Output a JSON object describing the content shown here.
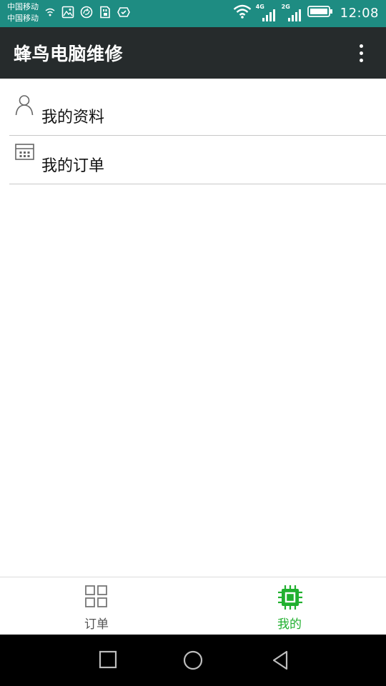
{
  "status_bar": {
    "carrier_1": "中国移动",
    "carrier_2": "中国移动",
    "network_1": "4G",
    "network_2": "2G",
    "time": "12:08"
  },
  "app_bar": {
    "title": "蜂鸟电脑维修"
  },
  "menu": {
    "items": [
      {
        "label": "我的资料",
        "icon": "person-icon"
      },
      {
        "label": "我的订单",
        "icon": "calendar-icon"
      }
    ]
  },
  "tabs": [
    {
      "label": "订单",
      "icon": "grid-icon",
      "active": false
    },
    {
      "label": "我的",
      "icon": "chip-icon",
      "active": true
    }
  ],
  "colors": {
    "status_bar": "#1e8c82",
    "app_bar": "#262b2c",
    "active_tab": "#21b02f",
    "inactive_tab": "#555555"
  }
}
